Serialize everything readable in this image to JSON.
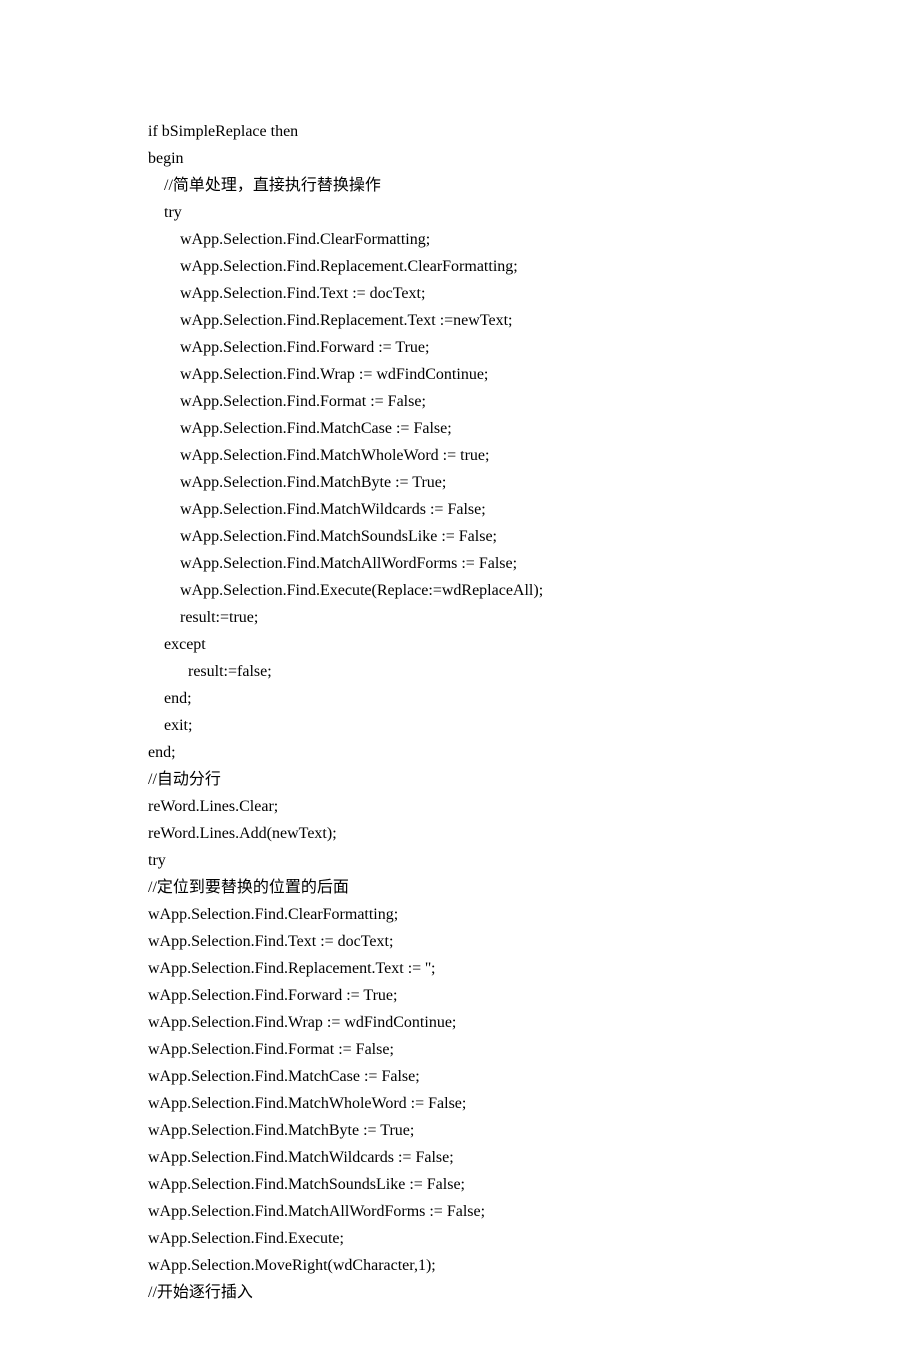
{
  "code": {
    "lines": [
      "if bSimpleReplace then",
      "begin",
      "    //简单处理，直接执行替换操作",
      "    try",
      "        wApp.Selection.Find.ClearFormatting;",
      "        wApp.Selection.Find.Replacement.ClearFormatting;",
      "        wApp.Selection.Find.Text := docText;",
      "        wApp.Selection.Find.Replacement.Text :=newText;",
      "        wApp.Selection.Find.Forward := True;",
      "        wApp.Selection.Find.Wrap := wdFindContinue;",
      "        wApp.Selection.Find.Format := False;",
      "        wApp.Selection.Find.MatchCase := False;",
      "        wApp.Selection.Find.MatchWholeWord := true;",
      "        wApp.Selection.Find.MatchByte := True;",
      "        wApp.Selection.Find.MatchWildcards := False;",
      "        wApp.Selection.Find.MatchSoundsLike := False;",
      "        wApp.Selection.Find.MatchAllWordForms := False;",
      "        wApp.Selection.Find.Execute(Replace:=wdReplaceAll);",
      "        result:=true;",
      "    except",
      "          result:=false;",
      "    end;",
      "    exit;",
      "end;",
      "//自动分行",
      "reWord.Lines.Clear;",
      "reWord.Lines.Add(newText);",
      "try",
      "//定位到要替换的位置的后面",
      "wApp.Selection.Find.ClearFormatting;",
      "wApp.Selection.Find.Text := docText;",
      "wApp.Selection.Find.Replacement.Text := '';",
      "wApp.Selection.Find.Forward := True;",
      "wApp.Selection.Find.Wrap := wdFindContinue;",
      "wApp.Selection.Find.Format := False;",
      "wApp.Selection.Find.MatchCase := False;",
      "wApp.Selection.Find.MatchWholeWord := False;",
      "wApp.Selection.Find.MatchByte := True;",
      "wApp.Selection.Find.MatchWildcards := False;",
      "wApp.Selection.Find.MatchSoundsLike := False;",
      "wApp.Selection.Find.MatchAllWordForms := False;",
      "wApp.Selection.Find.Execute;",
      "wApp.Selection.MoveRight(wdCharacter,1);",
      "//开始逐行插入"
    ]
  }
}
